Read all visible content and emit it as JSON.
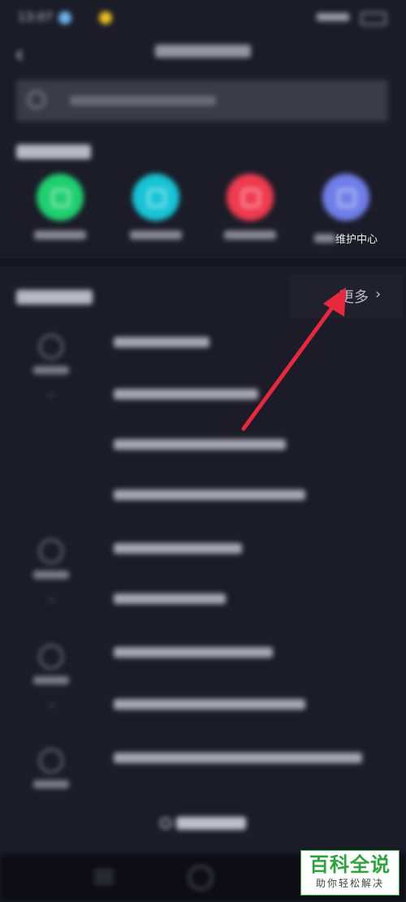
{
  "status_bar": {
    "time": "13:07",
    "right": ""
  },
  "header": {
    "back_glyph": "‹",
    "title": ""
  },
  "search": {
    "placeholder": ""
  },
  "self_service": {
    "title": "",
    "items": [
      {
        "label": "",
        "color": "#1fcf6f",
        "icon": "phone-icon"
      },
      {
        "label": "",
        "color": "#17c4d6",
        "icon": "device-icon"
      },
      {
        "label": "",
        "color": "#ef3b4f",
        "icon": "network-icon"
      },
      {
        "label": "维护中心",
        "color": "#6f7fe8",
        "icon": "maintenance-icon"
      }
    ]
  },
  "faq": {
    "title": "",
    "more_label": "更多",
    "more_chevron": "›",
    "categories": [
      {
        "label": "",
        "icon": "clock-icon"
      },
      {
        "label": "",
        "icon": "camera-icon"
      },
      {
        "label": "",
        "icon": "user-icon"
      },
      {
        "label": "",
        "icon": "settings-icon"
      }
    ],
    "questions": [
      "",
      "",
      "",
      "",
      "",
      "",
      "",
      "",
      ""
    ]
  },
  "bottom_link": {
    "label": ""
  },
  "watermark": {
    "main": "百科全说",
    "sub": "助你轻松解决"
  },
  "colors": {
    "background": "#1b1c28",
    "arrow": "#e8283c",
    "watermark_green": "#2ea33c"
  }
}
